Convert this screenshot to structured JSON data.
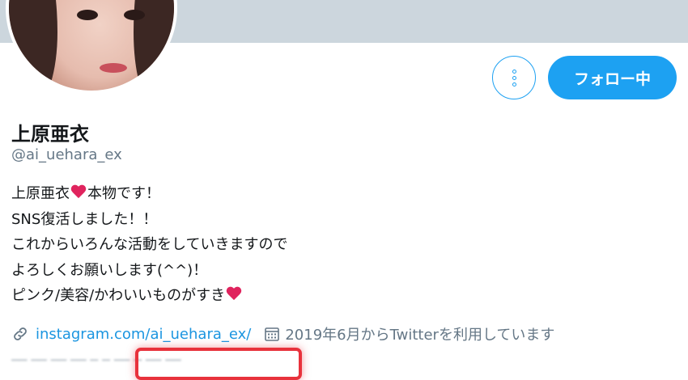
{
  "colors": {
    "accent": "#1da1f2",
    "link": "#1b95e0",
    "secondary_text": "#657786",
    "banner": "#ccd6dd",
    "heart": "#e0245e",
    "highlight": "#e8323c"
  },
  "profile": {
    "name": "上原亜衣",
    "handle": "@ai_uehara_ex",
    "bio": {
      "line1_prefix": "上原亜衣",
      "line1_suffix": "本物です！",
      "line2": "SNS復活しました！！",
      "line3": "これからいろんな活動をしていきますので",
      "line4": "よろしくお願いします(^^)！",
      "line5": "ピンク/美容/かわいいものがすき"
    },
    "link": "instagram.com/ai_uehara_ex/",
    "joined": "2019年6月からTwitterを利用しています"
  },
  "actions": {
    "follow_label": "フォロー中",
    "menu_icon": "more-vertical-icon"
  },
  "icons": {
    "link": "link-icon",
    "calendar": "calendar-icon",
    "heart": "heart-icon"
  },
  "bottom_row_blurred": "── ── ── ── ─ ─ ── ─ ── ──"
}
